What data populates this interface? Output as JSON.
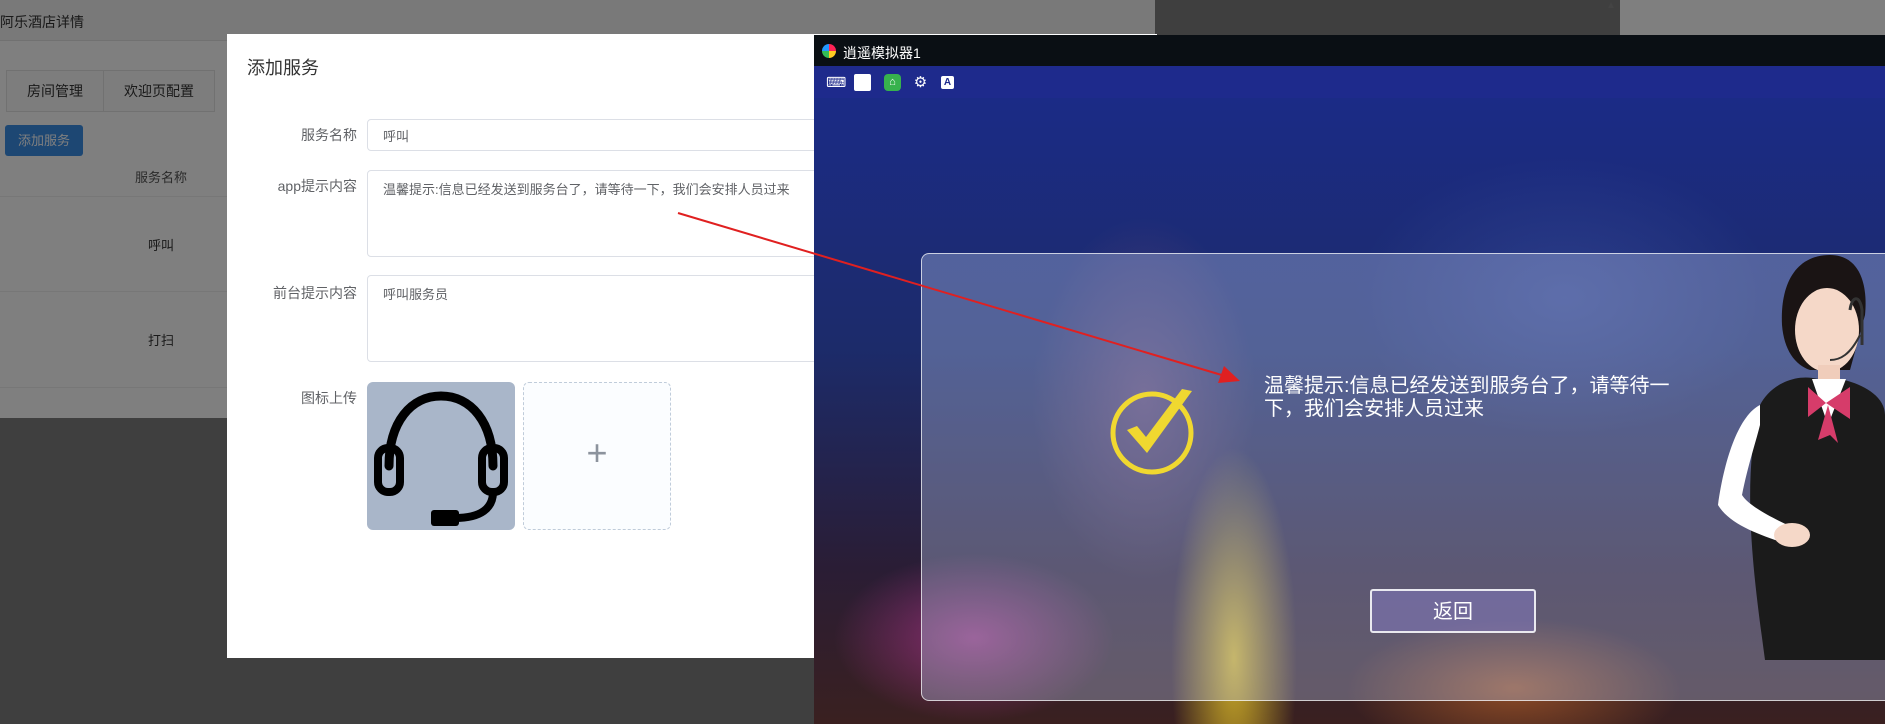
{
  "background_page": {
    "breadcrumb": "阿乐酒店详情",
    "tabs": [
      "房间管理",
      "欢迎页配置"
    ],
    "add_button": "添加服务",
    "column_header": "服务名称",
    "rows": [
      "呼叫",
      "打扫"
    ]
  },
  "dialog": {
    "title": "添加服务",
    "fields": {
      "service_name": {
        "label": "服务名称",
        "value": "呼叫"
      },
      "app_tip": {
        "label": "app提示内容",
        "value": "温馨提示:信息已经发送到服务台了，请等待一下，我们会安排人员过来"
      },
      "front_tip": {
        "label": "前台提示内容",
        "value": "呼叫服务员"
      },
      "icon_upload": {
        "label": "图标上传",
        "uploaded_icon": "headset-icon",
        "add_symbol": "+"
      }
    }
  },
  "emulator": {
    "title": "逍遥模拟器1",
    "toolbar_icons": [
      "keyboard-icon",
      "window-icon",
      "app-store-icon",
      "settings-icon",
      "text-input-icon"
    ],
    "screen": {
      "message": "温馨提示:信息已经发送到服务台了，请等待一下，我们会安排人员过来",
      "return_button": "返回",
      "check_icon_color": "#f0d830"
    }
  },
  "colors": {
    "primary_button": "#3a8ee6",
    "arrow": "#e02020",
    "emulator_toolbar": "#1e2a8c"
  }
}
